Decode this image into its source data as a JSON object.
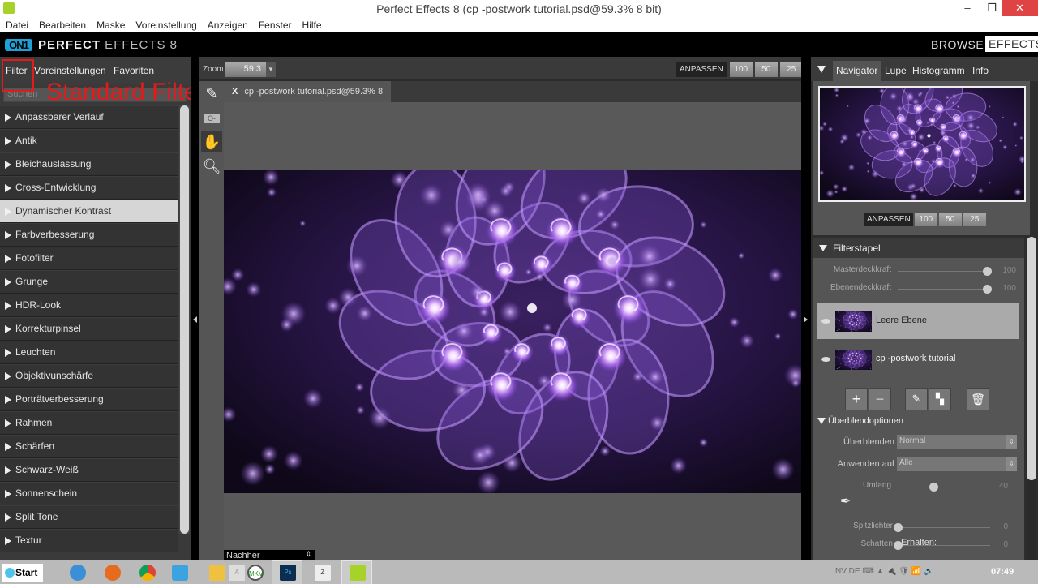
{
  "window": {
    "title": "Perfect Effects 8 (cp -postwork tutorial.psd@59.3% 8 bit)",
    "buttons": {
      "minimize": "–",
      "maximize": "❐",
      "close": "✕"
    }
  },
  "menu": [
    "Datei",
    "Bearbeiten",
    "Maske",
    "Voreinstellung",
    "Anzeigen",
    "Fenster",
    "Hilfe"
  ],
  "app": {
    "logo_mark": "ON1",
    "name_bold": "PERFECT",
    "name_rest": " EFFECTS 8",
    "modes": {
      "browse": "BROWSE",
      "effects": "EFFECTS"
    }
  },
  "left_panel": {
    "tabs": [
      "Filter",
      "Voreinstellungen",
      "Favoriten"
    ],
    "active_tab": "Filter",
    "search_placeholder": "Suchen",
    "annotation": "Standard Filter",
    "filters": [
      "Anpassbarer Verlauf",
      "Antik",
      "Bleichauslassung",
      "Cross-Entwicklung",
      "Dynamischer Kontrast",
      "Farbverbesserung",
      "Fotofilter",
      "Grunge",
      "HDR-Look",
      "Korrekturpinsel",
      "Leuchten",
      "Objektivunschärfe",
      "Porträtverbesserung",
      "Rahmen",
      "Schärfen",
      "Schwarz-Weiß",
      "Sonnenschein",
      "Split Tone",
      "Textur"
    ],
    "active_filter": "Dynamischer Kontrast"
  },
  "center": {
    "zoom_label": "Zoom",
    "zoom_value": "59,3",
    "fit_label": "ANPASSEN",
    "zoom_presets": [
      "100",
      "50",
      "25"
    ],
    "document_tab": "cp -postwork tutorial.psd@59.3% 8 bit",
    "close_tab": "X",
    "view_mode": "Nachher",
    "tools": [
      "brush-tool",
      "mask-tool",
      "hand-tool",
      "zoom-tool"
    ]
  },
  "right_panel": {
    "tabs": [
      "Navigator",
      "Lupe",
      "Histogramm",
      "Info"
    ],
    "active_tab": "Navigator",
    "nav_fit_label": "ANPASSEN",
    "nav_zoom_presets": [
      "100",
      "50",
      "25"
    ],
    "filterstack": {
      "title": "Filterstapel",
      "master_opacity": {
        "label": "Masterdeckkraft",
        "value": 100
      },
      "layer_opacity": {
        "label": "Ebenendeckkraft",
        "value": 100
      },
      "layers": [
        {
          "name": "Leere Ebene",
          "selected": true
        },
        {
          "name": "cp -postwork tutorial",
          "selected": false
        }
      ]
    },
    "blend": {
      "title": "Überblendoptionen",
      "blend_label": "Überblenden",
      "blend_value": "Normal",
      "apply_label": "Anwenden auf",
      "apply_value": "Alle",
      "range_label": "Umfang",
      "range_value": 40,
      "preserve_label": "Erhalten:",
      "highlights_label": "Spitzlichter",
      "highlights_value": 0,
      "shadows_label": "Schatten",
      "shadows_value": 0
    }
  },
  "taskbar": {
    "start_label": "Start",
    "tray_text": "NV DE",
    "clock": "07:49"
  },
  "colors": {
    "accent_logo": "#1da1d9",
    "annotation_red": "#e21b1b",
    "close_button": "#e04343"
  }
}
